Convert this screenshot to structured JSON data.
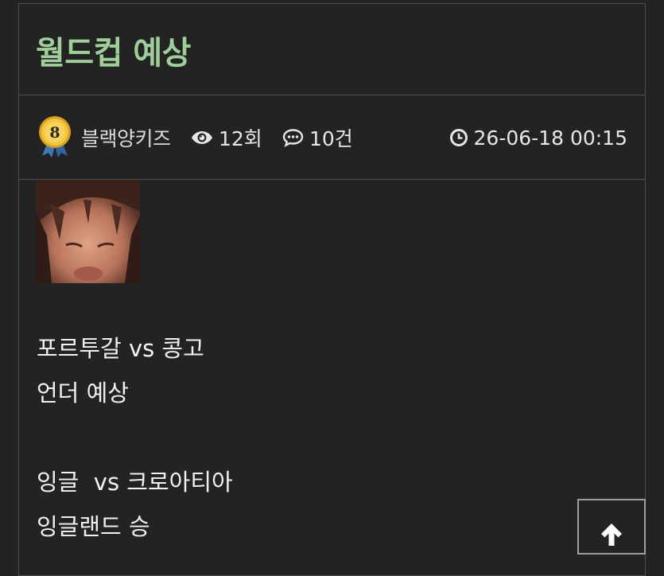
{
  "post": {
    "title": "월드컵 예상",
    "author": {
      "level": "8",
      "name": "블랙양키즈"
    },
    "views": "12회",
    "comments": "10건",
    "datetime": "26-06-18 00:15"
  },
  "body": {
    "lines": [
      "포르투갈 vs 콩고",
      "언더 예상",
      "잉글  vs 크로아티아",
      "잉글랜드 승"
    ]
  },
  "icons": {
    "level_badge": "level-medal-icon",
    "views": "eye-icon",
    "comments": "comment-icon",
    "datetime": "clock-icon",
    "scroll_top": "arrow-up-icon"
  },
  "colors": {
    "background": "#222322",
    "title": "#9fcf98",
    "text": "#f2f2f2",
    "border": "#4b4c4b"
  }
}
